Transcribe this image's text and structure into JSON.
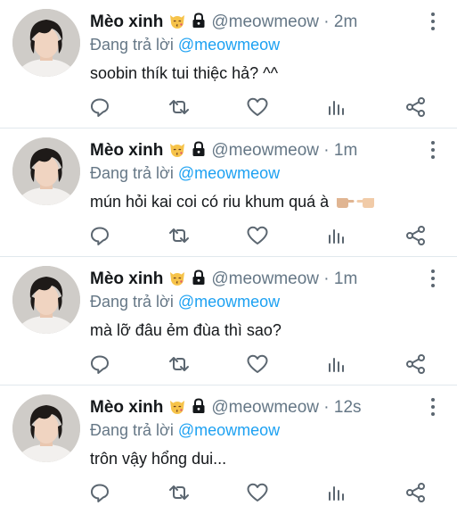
{
  "colors": {
    "mention": "#1da1f2",
    "muted": "#657786",
    "text": "#14171a",
    "separator": "#e1e8ed"
  },
  "icons": {
    "badge1": "kissing-cat-emoji",
    "badge2": "lock-icon",
    "reply": "reply-icon",
    "retweet": "retweet-icon",
    "like": "heart-icon",
    "stats": "stats-icon",
    "share": "share-icon",
    "more": "more-vertical-icon"
  },
  "tweets": [
    {
      "name": "Mèo xinh",
      "handle": "@meowmeow",
      "dot": "·",
      "time": "2m",
      "reply_prefix": "Đang trả lời",
      "reply_to": "@meowmeow",
      "text": "soobin thík tui thiệc hả? ^^",
      "hands": ""
    },
    {
      "name": "Mèo xinh",
      "handle": "@meowmeow",
      "dot": "·",
      "time": "1m",
      "reply_prefix": "Đang trả lời",
      "reply_to": "@meowmeow",
      "text": "mún hỏi kai coi có riu khum quá à",
      "hands": "pointing-hands-emoji"
    },
    {
      "name": "Mèo xinh",
      "handle": "@meowmeow",
      "dot": "·",
      "time": "1m",
      "reply_prefix": "Đang trả lời",
      "reply_to": "@meowmeow",
      "text": "mà lỡ đâu ẻm đùa thì sao?",
      "hands": ""
    },
    {
      "name": "Mèo xinh",
      "handle": "@meowmeow",
      "dot": "·",
      "time": "12s",
      "reply_prefix": "Đang trả lời",
      "reply_to": "@meowmeow",
      "text": "trôn vậy hổng dui...",
      "hands": ""
    }
  ]
}
